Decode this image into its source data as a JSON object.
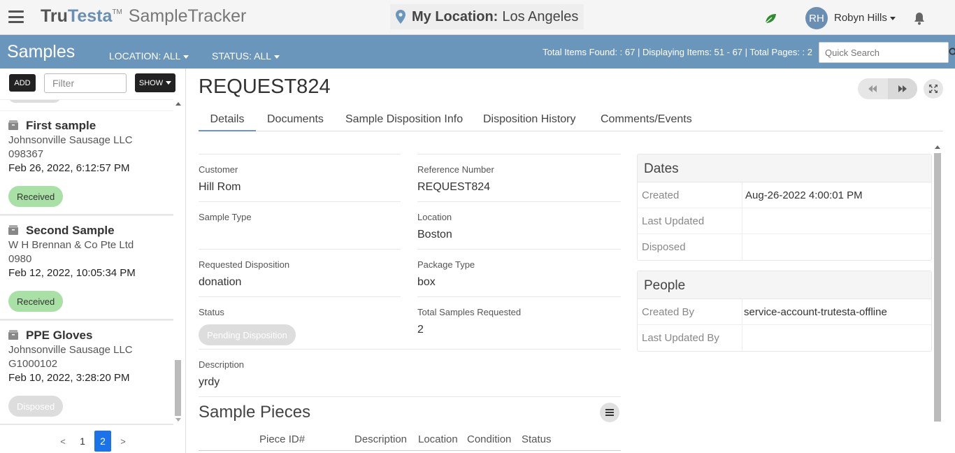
{
  "header": {
    "logo_tru": "Tru",
    "logo_testa": "Testa",
    "logo_tm": "TM",
    "logo_app": "SampleTracker",
    "location_label": "My Location:",
    "location_city": "Los Angeles",
    "user_initials": "RH",
    "user_name": "Robyn Hills"
  },
  "toolbar": {
    "title": "Samples",
    "location_filter": "LOCATION: ALL",
    "status_filter": "STATUS: ALL",
    "counts": "Total Items Found: : 67 | Displaying Items: 51 - 67 | Total Pages: : 2",
    "search_placeholder": "Quick Search"
  },
  "sidebar": {
    "add_label": "ADD",
    "filter_placeholder": "Filter",
    "show_label": "SHOW",
    "samples": [
      {
        "name": "First sample",
        "customer": "Johnsonville Sausage LLC",
        "number": "098367",
        "date": "Feb 26, 2022, 6:12:57 PM",
        "status": "Received"
      },
      {
        "name": "Second Sample",
        "customer": "W H Brennan & Co Pte Ltd",
        "number": "0980",
        "date": "Feb 12, 2022, 10:05:34 PM",
        "status": "Received"
      },
      {
        "name": "PPE Gloves",
        "customer": "Johnsonville Sausage LLC",
        "number": "G1000102",
        "date": "Feb 10, 2022, 3:28:20 PM",
        "status": "Disposed"
      }
    ],
    "pager": {
      "prev": "<",
      "pages": [
        "1",
        "2"
      ],
      "active": "2",
      "next": ">"
    }
  },
  "detail": {
    "title": "REQUEST824",
    "tabs": [
      "Details",
      "Documents",
      "Sample Disposition Info",
      "Disposition History",
      "Comments/Events"
    ],
    "fields": {
      "customer_label": "Customer",
      "customer": "Hill Rom",
      "reference_label": "Reference Number",
      "reference": "REQUEST824",
      "sample_type_label": "Sample Type",
      "sample_type": "",
      "location_label": "Location",
      "location": "Boston",
      "req_disp_label": "Requested Disposition",
      "req_disp": "donation",
      "package_label": "Package Type",
      "package": "box",
      "status_label": "Status",
      "status": "Pending Disposition",
      "total_label": "Total Samples Requested",
      "total": "2",
      "description_label": "Description",
      "description": "yrdy"
    },
    "pieces": {
      "title": "Sample Pieces",
      "columns": [
        "Piece ID#",
        "Description",
        "Location",
        "Condition",
        "Status"
      ]
    },
    "dates": {
      "title": "Dates",
      "created_label": "Created",
      "created": "Aug-26-2022 4:00:01 PM",
      "updated_label": "Last Updated",
      "updated": "",
      "disposed_label": "Disposed",
      "disposed": ""
    },
    "people": {
      "title": "People",
      "created_by_label": "Created By",
      "created_by": "service-account-trutesta-offline",
      "updated_by_label": "Last Updated By",
      "updated_by": ""
    }
  },
  "colors": {
    "accent": "#6b96bc",
    "received": "#a8e0a5",
    "pager_active": "#1a73e8",
    "leaf": "#2e8b2e"
  }
}
